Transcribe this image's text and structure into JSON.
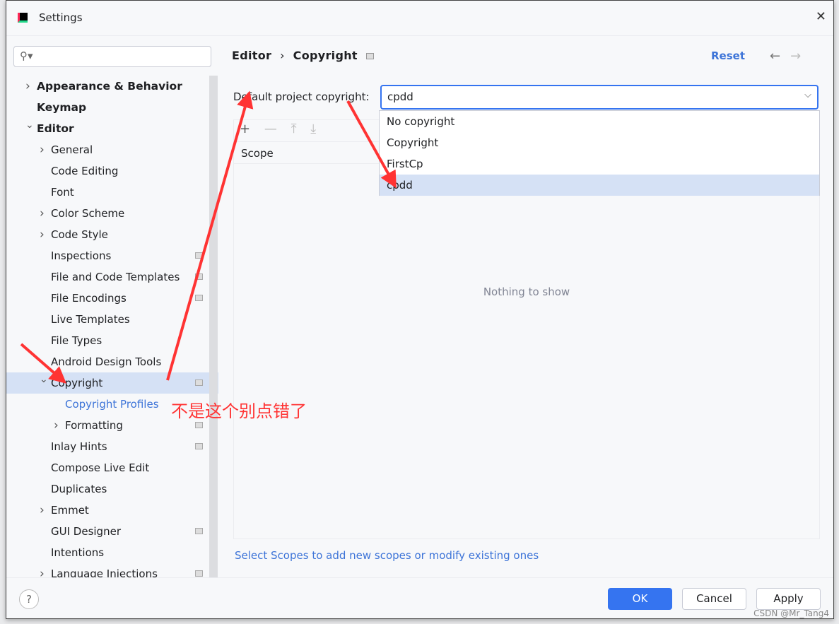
{
  "window": {
    "title": "Settings",
    "close_icon": "close-icon"
  },
  "search": {
    "placeholder": ""
  },
  "tree": [
    {
      "label": "Appearance & Behavior",
      "level": 0,
      "arrow": "right",
      "bold": true
    },
    {
      "label": "Keymap",
      "level": 0,
      "bold": true
    },
    {
      "label": "Editor",
      "level": 0,
      "arrow": "down",
      "bold": true
    },
    {
      "label": "General",
      "level": 1,
      "arrow": "right"
    },
    {
      "label": "Code Editing",
      "level": 1
    },
    {
      "label": "Font",
      "level": 1
    },
    {
      "label": "Color Scheme",
      "level": 1,
      "arrow": "right"
    },
    {
      "label": "Code Style",
      "level": 1,
      "arrow": "right"
    },
    {
      "label": "Inspections",
      "level": 1,
      "project": true
    },
    {
      "label": "File and Code Templates",
      "level": 1,
      "project": true
    },
    {
      "label": "File Encodings",
      "level": 1,
      "project": true
    },
    {
      "label": "Live Templates",
      "level": 1
    },
    {
      "label": "File Types",
      "level": 1
    },
    {
      "label": "Android Design Tools",
      "level": 1
    },
    {
      "label": "Copyright",
      "level": 1,
      "arrow": "down",
      "project": true,
      "selected": true
    },
    {
      "label": "Copyright Profiles",
      "level": 2,
      "link": true
    },
    {
      "label": "Formatting",
      "level": 2,
      "arrow": "right",
      "project": true
    },
    {
      "label": "Inlay Hints",
      "level": 1,
      "project": true
    },
    {
      "label": "Compose Live Edit",
      "level": 1
    },
    {
      "label": "Duplicates",
      "level": 1
    },
    {
      "label": "Emmet",
      "level": 1,
      "arrow": "right"
    },
    {
      "label": "GUI Designer",
      "level": 1,
      "project": true
    },
    {
      "label": "Intentions",
      "level": 1
    },
    {
      "label": "Language Injections",
      "level": 1,
      "arrow": "right",
      "project": true
    }
  ],
  "breadcrumb": {
    "parent": "Editor",
    "sep": "›",
    "current": "Copyright"
  },
  "header": {
    "reset": "Reset",
    "back": "←",
    "forward": "→"
  },
  "form": {
    "label": "Default project copyright:",
    "value": "cpdd",
    "chevron": "⌵"
  },
  "dropdown": {
    "options": [
      "No copyright",
      "Copyright",
      "FirstCp",
      "cpdd"
    ],
    "selected": 3
  },
  "toolbar": {
    "add": "+",
    "remove": "—",
    "up": "⤒",
    "down": "⤓"
  },
  "table": {
    "column": "Scope",
    "empty": "Nothing to show"
  },
  "hint": "Select Scopes to add new scopes or modify existing ones",
  "footer": {
    "help": "?",
    "ok": "OK",
    "cancel": "Cancel",
    "apply": "Apply"
  },
  "annotation": {
    "text": "不是这个别点错了",
    "color": "#f33"
  },
  "watermark": "CSDN @Mr_Tang4",
  "colors": {
    "accent": "#3574f0",
    "link": "#3d74d8",
    "selection": "#d5e1f5"
  }
}
